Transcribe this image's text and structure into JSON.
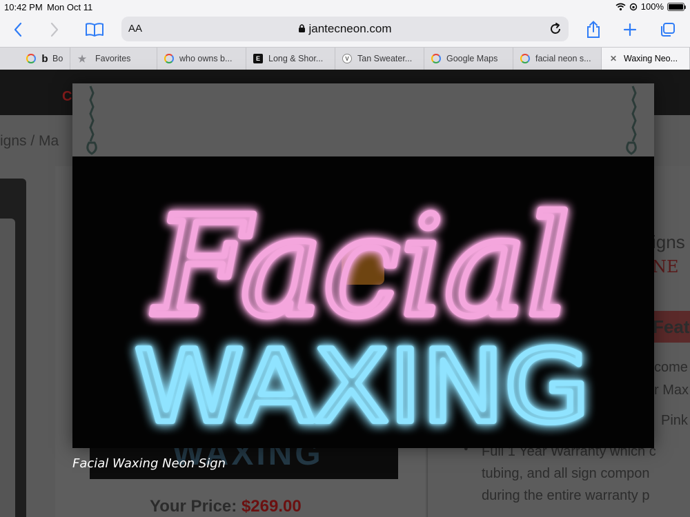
{
  "status_bar": {
    "time": "10:42 PM",
    "date": "Mon Oct 11",
    "battery": "100%",
    "battery_level": 1.0
  },
  "toolbar": {
    "text_size_label": "AA",
    "url": "jantecneon.com",
    "icons": [
      "back-icon",
      "forward-icon",
      "bookmarks-icon",
      "lock-icon",
      "reload-icon",
      "share-icon",
      "new-tab-icon",
      "tabs-overview-icon"
    ]
  },
  "tabs": [
    {
      "label": "Bo",
      "icon": "bing-icon"
    },
    {
      "label": "Favorites",
      "icon": "star-icon"
    },
    {
      "label": "who owns b...",
      "icon": "google-icon"
    },
    {
      "label": "Long & Shor...",
      "icon": "e-icon"
    },
    {
      "label": "Tan Sweater...",
      "icon": "v-icon"
    },
    {
      "label": "Google Maps",
      "icon": "google-icon"
    },
    {
      "label": "facial neon s...",
      "icon": "google-icon"
    },
    {
      "label": "Waxing Neo...",
      "icon": "close-icon",
      "active": true
    }
  ],
  "page": {
    "header_letter": "C",
    "breadcrumb": "igns  /  Ma",
    "thumb_text": "WAXING",
    "price_label": "Your Price:",
    "price_value": "$269.00",
    "right_fragments": {
      "signs": "igns",
      "neon": "NE",
      "features": "Feat",
      "line1": "come",
      "line2": "r Max",
      "line3": "Pink",
      "bullet1": "Full 1 Year Warranty which c",
      "bullet2": "tubing, and all sign compon",
      "bullet3": "during the entire warranty p"
    }
  },
  "lightbox": {
    "sign_line1": "Facial",
    "sign_line2": "WAXING",
    "caption": "Facial Waxing Neon Sign",
    "colors": {
      "pink": "#f4a6dd",
      "pink_glow": "#ff4fc8",
      "blue": "#8fe3ff",
      "blue_glow": "#1aa6ff"
    }
  }
}
